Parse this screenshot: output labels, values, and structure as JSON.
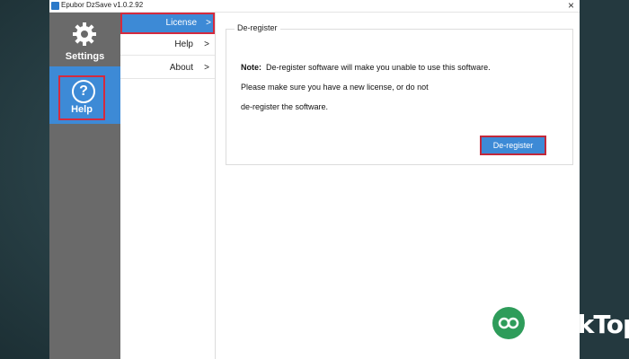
{
  "window": {
    "title": "Epubor DzSave v1.0.2.92",
    "close_glyph": "×"
  },
  "sidebar": {
    "items": [
      {
        "label": "Settings",
        "icon": "gear-icon"
      },
      {
        "label": "Help",
        "icon": "help-icon",
        "icon_glyph": "?"
      }
    ]
  },
  "submenu": {
    "items": [
      {
        "label": "License",
        "arrow": ">"
      },
      {
        "label": "Help",
        "arrow": ">"
      },
      {
        "label": "About",
        "arrow": ">"
      }
    ]
  },
  "panel": {
    "title": "De-register",
    "note_label": "Note:",
    "note_line1": "De-register software will make you unable to use this software.",
    "note_line2": "Please make sure you have a new license, or do not",
    "note_line3": "de-register the software.",
    "button_label": "De-register"
  },
  "watermark": {
    "text": "ßeskTop"
  },
  "colors": {
    "accent": "#3d8ad6",
    "sidebar": "#6a6a6a",
    "highlight": "#d42a3e"
  }
}
